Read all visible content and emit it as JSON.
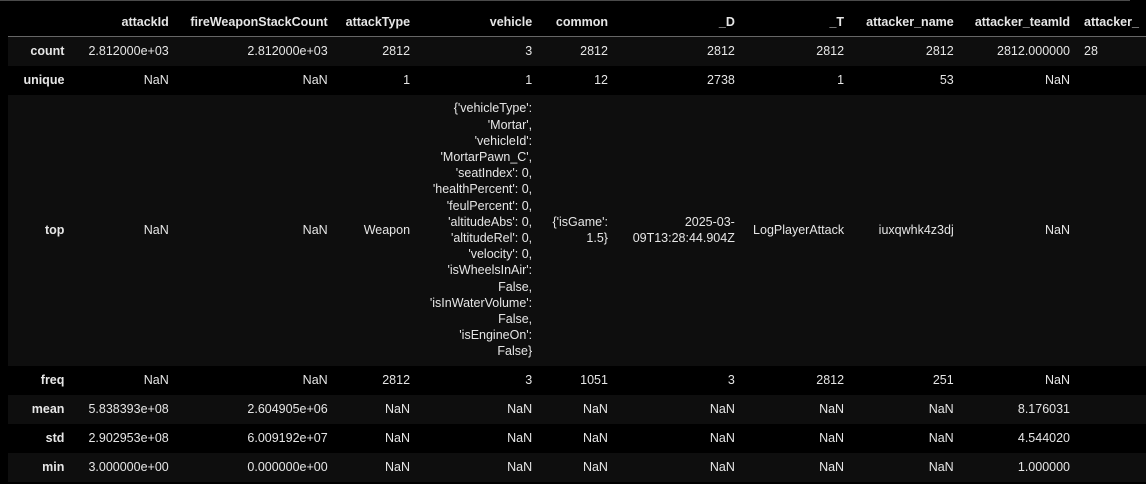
{
  "columns": [
    "",
    "attackId",
    "fireWeaponStackCount",
    "attackType",
    "vehicle",
    "common",
    "_D",
    "_T",
    "attacker_name",
    "attacker_teamId",
    "attacker_"
  ],
  "rows": [
    {
      "label": "count",
      "cells": [
        "2.812000e+03",
        "2.812000e+03",
        "2812",
        "3",
        "2812",
        "2812",
        "2812",
        "2812",
        "2812.000000",
        "28"
      ]
    },
    {
      "label": "unique",
      "cells": [
        "NaN",
        "NaN",
        "1",
        "1",
        "12",
        "2738",
        "1",
        "53",
        "NaN",
        ""
      ]
    },
    {
      "label": "top",
      "cells": [
        "NaN",
        "NaN",
        "Weapon",
        "",
        "",
        "",
        "LogPlayerAttack",
        "iuxqwhk4z3dj",
        "NaN",
        ""
      ]
    },
    {
      "label": "freq",
      "cells": [
        "NaN",
        "NaN",
        "2812",
        "3",
        "1051",
        "3",
        "2812",
        "251",
        "NaN",
        ""
      ]
    },
    {
      "label": "mean",
      "cells": [
        "5.838393e+08",
        "2.604905e+06",
        "NaN",
        "NaN",
        "NaN",
        "NaN",
        "NaN",
        "NaN",
        "8.176031",
        ""
      ]
    },
    {
      "label": "std",
      "cells": [
        "2.902953e+08",
        "6.009192e+07",
        "NaN",
        "NaN",
        "NaN",
        "NaN",
        "NaN",
        "NaN",
        "4.544020",
        ""
      ]
    },
    {
      "label": "min",
      "cells": [
        "3.000000e+00",
        "0.000000e+00",
        "NaN",
        "NaN",
        "NaN",
        "NaN",
        "NaN",
        "NaN",
        "1.000000",
        ""
      ]
    }
  ],
  "top_vehicle_lines": [
    "{'vehicleType':",
    "'Mortar',",
    "'vehicleId':",
    "'MortarPawn_C',",
    "'seatIndex': 0,",
    "'healthPercent': 0,",
    "'feulPercent': 0,",
    "'altitudeAbs': 0,",
    "'altitudeRel': 0,",
    "'velocity': 0,",
    "'isWheelsInAir':",
    "False,",
    "'isInWaterVolume':",
    "False,",
    "'isEngineOn':",
    "False}"
  ],
  "top_common_lines": [
    "{'isGame':",
    "1.5}"
  ],
  "top_d_lines": [
    "2025-03-",
    "09T13:28:44.904Z"
  ]
}
